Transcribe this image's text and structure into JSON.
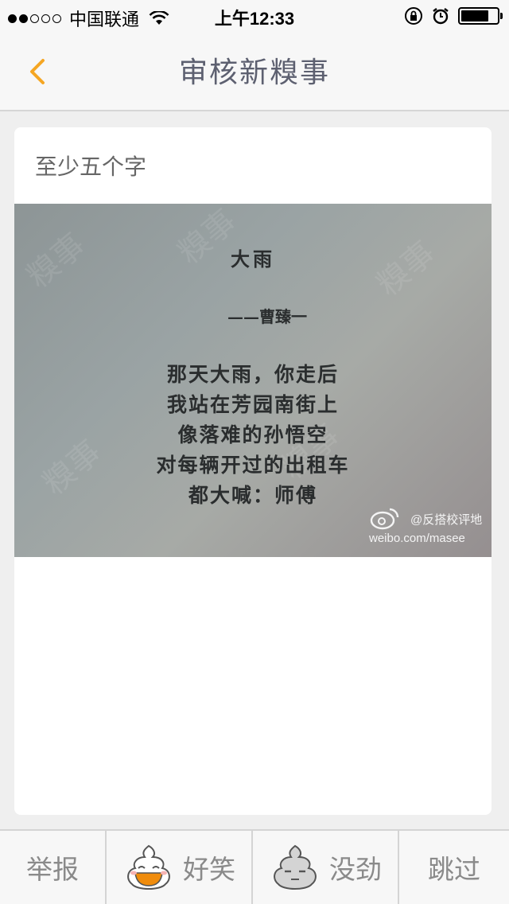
{
  "status_bar": {
    "carrier": "中国联通",
    "time": "上午12:33"
  },
  "nav": {
    "title": "审核新糗事",
    "back_icon": "chevron-left-icon",
    "accent": "#f5a623"
  },
  "post": {
    "text": "至少五个字",
    "image": {
      "poem_title": "大雨",
      "poem_author": "——曹臻一",
      "poem_lines": [
        "那天大雨，你走后",
        "我站在芳园南街上",
        "像落难的孙悟空",
        "对每辆开过的出租车",
        "都大喊：师傅"
      ],
      "watermark_handle": "@反搭校评地",
      "watermark_url": "weibo.com/masee"
    }
  },
  "actions": {
    "report": "举报",
    "funny": "好笑",
    "boring": "没劲",
    "skip": "跳过"
  }
}
